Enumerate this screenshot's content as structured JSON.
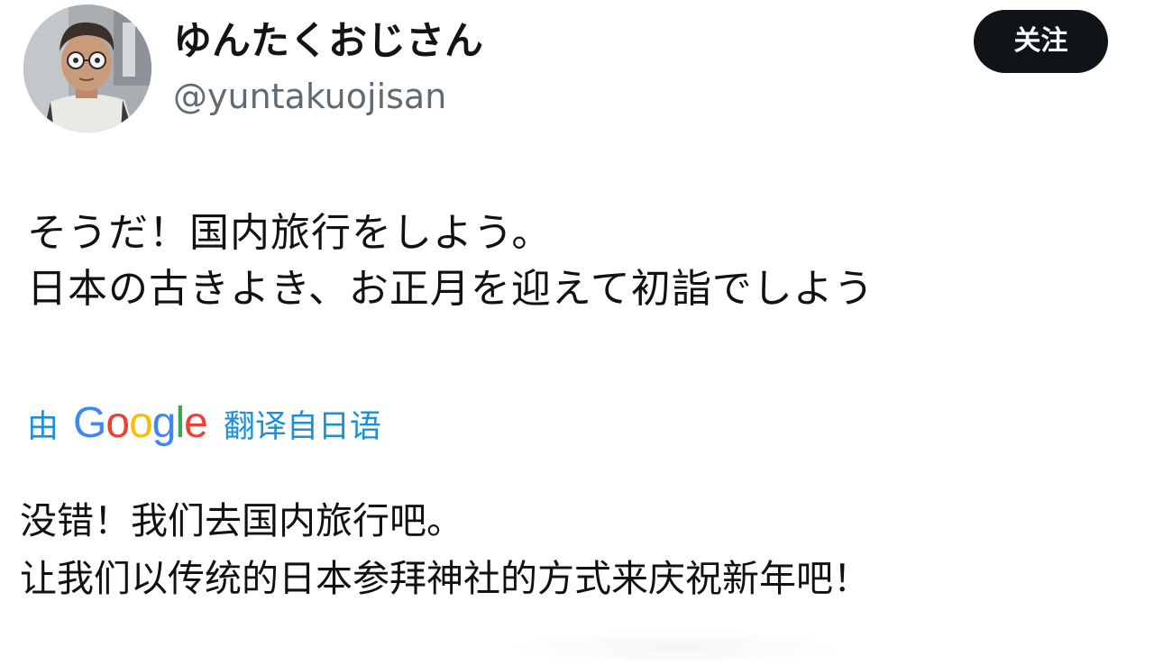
{
  "user": {
    "display_name": "ゆんたくおじさん",
    "handle": "@yuntakuojisan"
  },
  "follow_button": {
    "label": "关注"
  },
  "post": {
    "lines": [
      "そうだ！国内旅行をしよう。",
      "日本の古きよき、お正月を迎えて初詣でしよう"
    ]
  },
  "translate": {
    "prefix": "由",
    "provider": "Google",
    "suffix": "翻译自日语"
  },
  "translation": {
    "lines": [
      "没错！我们去国内旅行吧。",
      "让我们以传统的日本参拜神社的方式来庆祝新年吧！"
    ]
  },
  "colors": {
    "link": "#1d8fd6",
    "follow_bg": "#0f1419",
    "handle": "#5f6a72",
    "google_blue": "#4285F4",
    "google_red": "#EA4335",
    "google_yellow": "#FBBC05",
    "google_green": "#34A853"
  }
}
